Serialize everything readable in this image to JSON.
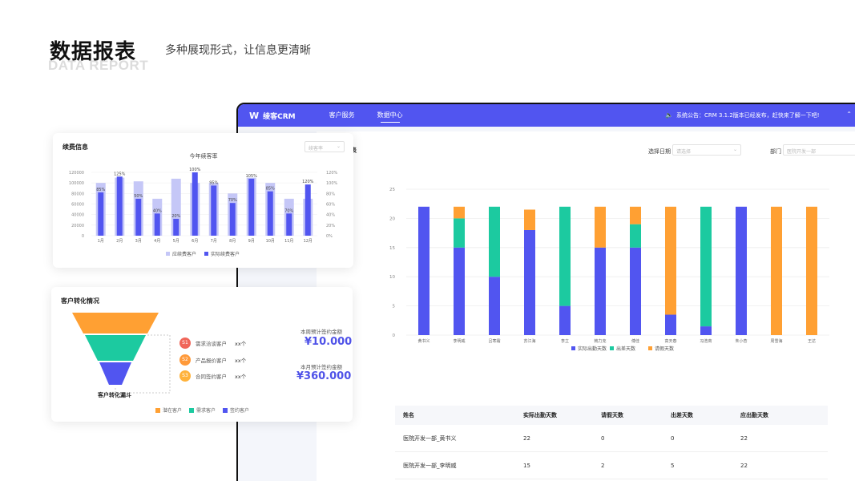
{
  "hero": {
    "title": "数据报表",
    "subtitle": "DATA REPORT",
    "description": "多种展现形式，让信息更清晰"
  },
  "app": {
    "logo": "绫客CRM",
    "logo_mark": "W",
    "nav": [
      "客户服务",
      "数据中心"
    ],
    "notice": "系统公告：CRM 3.1.2版本已经发布，赶快来了解一下吧!",
    "nav_right": "⌃",
    "report_title": "报表",
    "filters": {
      "date_label": "选择日期",
      "date_placeholder": "请选择",
      "dept_label": "部门",
      "dept_placeholder": "医院开发一部"
    }
  },
  "colors": {
    "primary": "#5155f0",
    "green": "#1ccaa0",
    "orange": "#ffa033",
    "light_bar": "#c5c7f7"
  },
  "attendance_chart": {
    "type": "bar",
    "stacked": true,
    "ylim": [
      0,
      25
    ],
    "yticks": [
      0,
      5,
      10,
      15,
      20,
      25
    ],
    "categories": [
      "黄书义",
      "李明威",
      "吕寒霜",
      "苏江海",
      "李立",
      "韩力克",
      "傅佳",
      "高天春",
      "冯浩商",
      "朱小杏",
      "周雪海",
      "王达"
    ],
    "series": [
      {
        "name": "实际出勤天数",
        "color": "#5155f0",
        "values": [
          22,
          15,
          10,
          18,
          5,
          15,
          15,
          3.5,
          1.5,
          22,
          0,
          0
        ]
      },
      {
        "name": "出差天数",
        "color": "#1ccaa0",
        "values": [
          0,
          5,
          12,
          0,
          17,
          0,
          4,
          0,
          20.5,
          0,
          0,
          0
        ]
      },
      {
        "name": "请假天数",
        "color": "#ffa033",
        "values": [
          0,
          2,
          0,
          3.5,
          0,
          7,
          3,
          18.5,
          0,
          0,
          22,
          22
        ]
      }
    ]
  },
  "table": {
    "headers": [
      "姓名",
      "实际出勤天数",
      "请假天数",
      "出差天数",
      "应出勤天数"
    ],
    "rows": [
      [
        "医院开发一部_黄书义",
        "22",
        "0",
        "0",
        "22"
      ],
      [
        "医院开发一部_李明威",
        "15",
        "2",
        "5",
        "22"
      ]
    ]
  },
  "renewal_card": {
    "title": "续费信息",
    "chart_title": "今年续客率",
    "select_placeholder": "续客率",
    "chart_data": {
      "type": "bar",
      "categories": [
        "1月",
        "2月",
        "3月",
        "4月",
        "5月",
        "6月",
        "7月",
        "8月",
        "9月",
        "10月",
        "11月",
        "12月"
      ],
      "series": [
        {
          "name": "应续费客户",
          "color": "#c5c7f7",
          "values": [
            100000,
            110000,
            103000,
            70000,
            108000,
            100000,
            100000,
            80000,
            110000,
            100000,
            70000,
            70000
          ]
        },
        {
          "name": "实际续费客户",
          "color": "#5155f0",
          "values": [
            82000,
            112000,
            70000,
            42000,
            32000,
            120000,
            95000,
            62000,
            108000,
            84000,
            42000,
            97000
          ]
        }
      ],
      "rate_labels": [
        "85%",
        "125%",
        "50%",
        "40%",
        "20%",
        "100%",
        "95%",
        "70%",
        "105%",
        "85%",
        "70%",
        "120%"
      ],
      "ylim": [
        0,
        120000
      ],
      "yticks": [
        "120000",
        "100000",
        "80000",
        "60000",
        "40000",
        "20000",
        "0"
      ],
      "y2ticks": [
        "120%",
        "100%",
        "80%",
        "60%",
        "40%",
        "20%",
        "0%"
      ]
    }
  },
  "funnel_card": {
    "title": "客户转化情况",
    "funnel_caption": "客户转化漏斗",
    "steps": [
      {
        "badge": "S1",
        "label": "需求洽谈客户",
        "count": "xx个",
        "color": "#f0665a"
      },
      {
        "badge": "S2",
        "label": "产品报价客户",
        "count": "xx个",
        "color": "#ff9a3a"
      },
      {
        "badge": "S3",
        "label": "合同签约客户",
        "count": "xx个",
        "color": "#ffb23a"
      }
    ],
    "week_label": "本周预计签约金额",
    "week_amount": "¥10.000",
    "month_label": "本月预计签约金额",
    "month_amount": "¥360.000",
    "legend": [
      {
        "name": "潜在客户",
        "color": "#ffa033"
      },
      {
        "name": "需求客户",
        "color": "#1ccaa0"
      },
      {
        "name": "签约客户",
        "color": "#5155f0"
      }
    ]
  }
}
